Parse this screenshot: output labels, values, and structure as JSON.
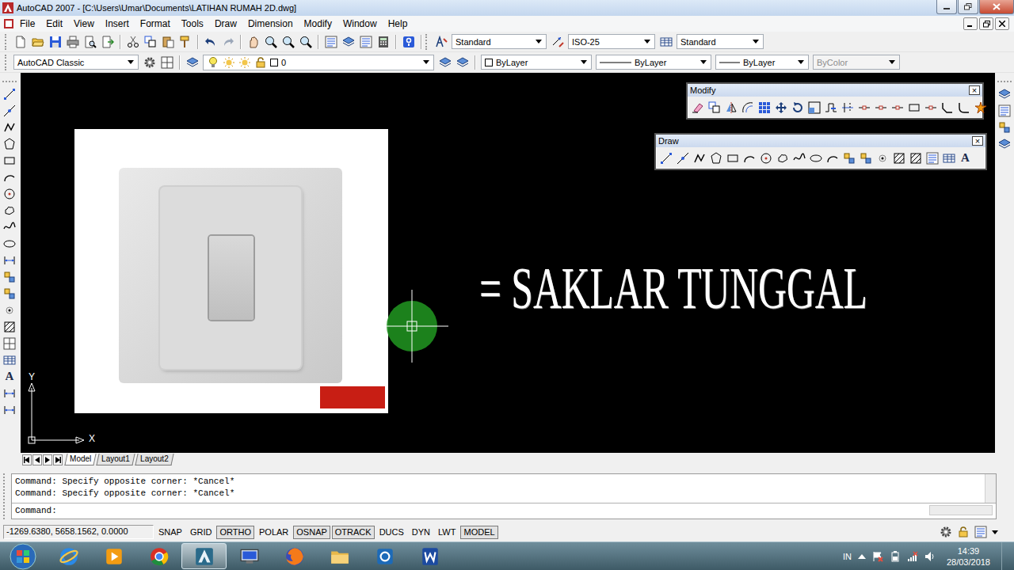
{
  "window": {
    "title": "AutoCAD 2007 - [C:\\Users\\Umar\\Documents\\LATIHAN RUMAH 2D.dwg]"
  },
  "menu": [
    "File",
    "Edit",
    "View",
    "Insert",
    "Format",
    "Tools",
    "Draw",
    "Dimension",
    "Modify",
    "Window",
    "Help"
  ],
  "styles_toolbar": {
    "text_style": "Standard",
    "dim_style": "ISO-25",
    "table_style": "Standard"
  },
  "workspace": "AutoCAD Classic",
  "layers": {
    "current": "0"
  },
  "properties": {
    "color": "ByLayer",
    "linetype": "ByLayer",
    "lineweight": "ByLayer",
    "plot_style": {
      "label": "ByColor",
      "disabled": true
    }
  },
  "floating_toolbars": [
    {
      "title": "Modify",
      "close": "×"
    },
    {
      "title": "Draw",
      "close": "×"
    }
  ],
  "text_tool": "A",
  "canvas": {
    "annotation": "= SAKLAR TUNGGAL",
    "ucs": {
      "x": "X",
      "y": "Y"
    }
  },
  "layout_tabs": [
    {
      "label": "Model",
      "selected": true
    },
    {
      "label": "Layout1",
      "selected": false
    },
    {
      "label": "Layout2",
      "selected": false
    }
  ],
  "command_history": [
    "Command: Specify opposite corner: *Cancel*",
    "Command: Specify opposite corner: *Cancel*"
  ],
  "command_prompt": "Command:",
  "status_bar": {
    "coordinates": "-1269.6380, 5658.1562, 0.0000",
    "toggles": [
      {
        "label": "SNAP",
        "on": false
      },
      {
        "label": "GRID",
        "on": false
      },
      {
        "label": "ORTHO",
        "on": true
      },
      {
        "label": "POLAR",
        "on": false
      },
      {
        "label": "OSNAP",
        "on": true
      },
      {
        "label": "OTRACK",
        "on": true
      },
      {
        "label": "DUCS",
        "on": false
      },
      {
        "label": "DYN",
        "on": false
      },
      {
        "label": "LWT",
        "on": false
      },
      {
        "label": "MODEL",
        "on": true
      }
    ]
  },
  "taskbar": {
    "language": "IN",
    "time": "14:39",
    "date": "28/03/2018",
    "apps": [
      {
        "kind": "ie",
        "selected": false
      },
      {
        "kind": "media",
        "selected": false
      },
      {
        "kind": "chrome",
        "selected": false
      },
      {
        "kind": "autocad",
        "selected": true
      },
      {
        "kind": "monitor",
        "selected": false
      },
      {
        "kind": "firefox",
        "selected": false
      },
      {
        "kind": "explorer",
        "selected": false
      },
      {
        "kind": "network",
        "selected": false
      },
      {
        "kind": "word",
        "selected": false
      }
    ]
  }
}
